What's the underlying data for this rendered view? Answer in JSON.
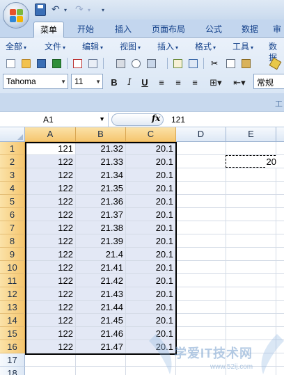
{
  "tabs": [
    {
      "label": "菜单",
      "active": true
    },
    {
      "label": "开始",
      "active": false
    },
    {
      "label": "插入",
      "active": false
    },
    {
      "label": "页面布局",
      "active": false
    },
    {
      "label": "公式",
      "active": false
    },
    {
      "label": "数据",
      "active": false
    },
    {
      "label": "审",
      "active": false
    }
  ],
  "menus": [
    "全部",
    "文件",
    "编辑",
    "视图",
    "插入",
    "格式",
    "工具",
    "数据"
  ],
  "font": {
    "name": "Tahoma",
    "size": "11",
    "number_format": "常规"
  },
  "ribbon_group_label": "工",
  "formula_bar": {
    "name_box": "A1",
    "fx_label": "fx",
    "value": "121"
  },
  "columns": [
    "A",
    "B",
    "C",
    "D",
    "E"
  ],
  "rows": [
    {
      "n": "1",
      "a": "121",
      "b": "21.32",
      "c": "20.1",
      "e": ""
    },
    {
      "n": "2",
      "a": "122",
      "b": "21.33",
      "c": "20.1",
      "e": "20"
    },
    {
      "n": "3",
      "a": "122",
      "b": "21.34",
      "c": "20.1",
      "e": ""
    },
    {
      "n": "4",
      "a": "122",
      "b": "21.35",
      "c": "20.1",
      "e": ""
    },
    {
      "n": "5",
      "a": "122",
      "b": "21.36",
      "c": "20.1",
      "e": ""
    },
    {
      "n": "6",
      "a": "122",
      "b": "21.37",
      "c": "20.1",
      "e": ""
    },
    {
      "n": "7",
      "a": "122",
      "b": "21.38",
      "c": "20.1",
      "e": ""
    },
    {
      "n": "8",
      "a": "122",
      "b": "21.39",
      "c": "20.1",
      "e": ""
    },
    {
      "n": "9",
      "a": "122",
      "b": "21.4",
      "c": "20.1",
      "e": ""
    },
    {
      "n": "10",
      "a": "122",
      "b": "21.41",
      "c": "20.1",
      "e": ""
    },
    {
      "n": "11",
      "a": "122",
      "b": "21.42",
      "c": "20.1",
      "e": ""
    },
    {
      "n": "12",
      "a": "122",
      "b": "21.43",
      "c": "20.1",
      "e": ""
    },
    {
      "n": "13",
      "a": "122",
      "b": "21.44",
      "c": "20.1",
      "e": ""
    },
    {
      "n": "14",
      "a": "122",
      "b": "21.45",
      "c": "20.1",
      "e": ""
    },
    {
      "n": "15",
      "a": "122",
      "b": "21.46",
      "c": "20.1",
      "e": ""
    },
    {
      "n": "16",
      "a": "122",
      "b": "21.47",
      "c": "20.1",
      "e": ""
    },
    {
      "n": "17",
      "a": "",
      "b": "",
      "c": "",
      "e": ""
    },
    {
      "n": "18",
      "a": "",
      "b": "",
      "c": "",
      "e": ""
    }
  ],
  "selection": "A1:C16",
  "copy_marquee": {
    "cell": "E2",
    "value": "20"
  },
  "watermark": {
    "text": "学爱IT技术网",
    "url": "www.52ij.com"
  },
  "colors": {
    "accent": "#15428b",
    "selection_header": "#f5c66f",
    "selection_fill": "#e3e8f5"
  }
}
